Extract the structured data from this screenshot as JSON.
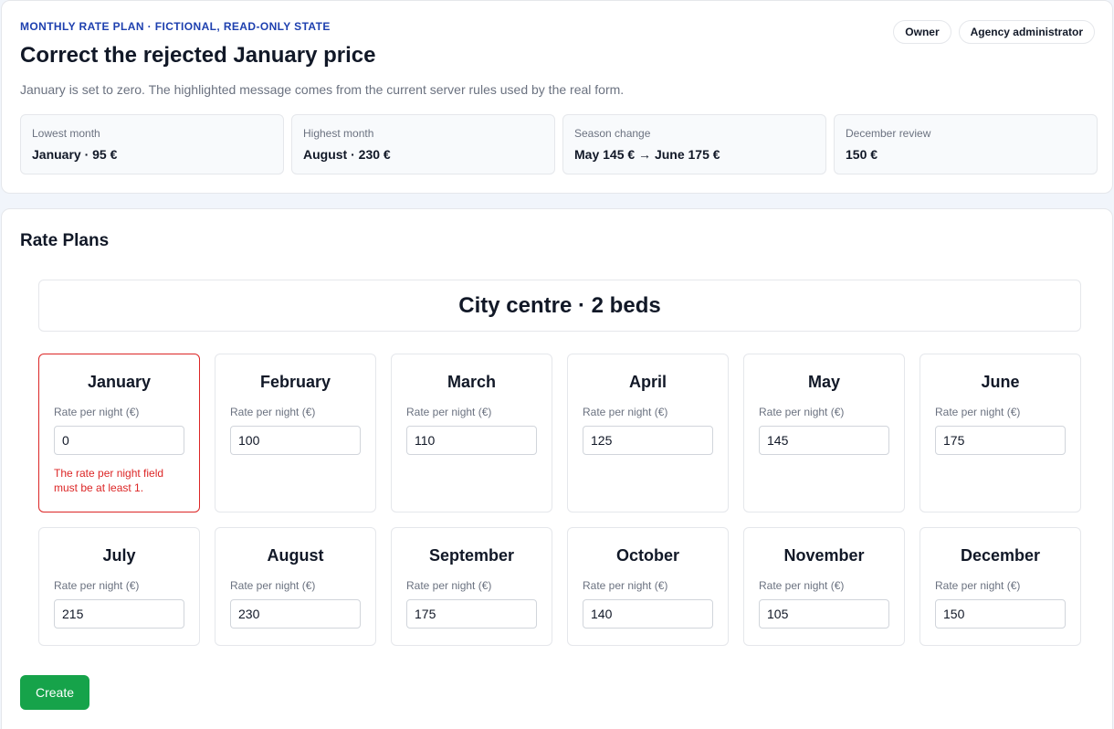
{
  "header": {
    "eyebrow": "MONTHLY RATE PLAN · FICTIONAL, READ-ONLY STATE",
    "title": "Correct the rejected January price",
    "subtitle": "January is set to zero. The highlighted message comes from the current server rules used by the real form.",
    "roles": [
      "Owner",
      "Agency administrator"
    ]
  },
  "stats": [
    {
      "label": "Lowest month",
      "value": "January · 95 €"
    },
    {
      "label": "Highest month",
      "value": "August · 230 €"
    },
    {
      "label": "Season change",
      "value": "May 145 € → June 175 €"
    },
    {
      "label": "December review",
      "value": "150 €"
    }
  ],
  "rates": {
    "section_title": "Rate Plans",
    "plan_name": "City centre · 2 beds",
    "field_label": "Rate per night (€)",
    "months": [
      {
        "name": "January",
        "value": "0",
        "error": "The rate per night field must be at least 1."
      },
      {
        "name": "February",
        "value": "100"
      },
      {
        "name": "March",
        "value": "110"
      },
      {
        "name": "April",
        "value": "125"
      },
      {
        "name": "May",
        "value": "145"
      },
      {
        "name": "June",
        "value": "175"
      },
      {
        "name": "July",
        "value": "215"
      },
      {
        "name": "August",
        "value": "230"
      },
      {
        "name": "September",
        "value": "175"
      },
      {
        "name": "October",
        "value": "140"
      },
      {
        "name": "November",
        "value": "105"
      },
      {
        "name": "December",
        "value": "150"
      }
    ],
    "create_label": "Create"
  },
  "colors": {
    "accent": "#1e40af",
    "error": "#dc2626",
    "primary_button": "#16a34a"
  }
}
